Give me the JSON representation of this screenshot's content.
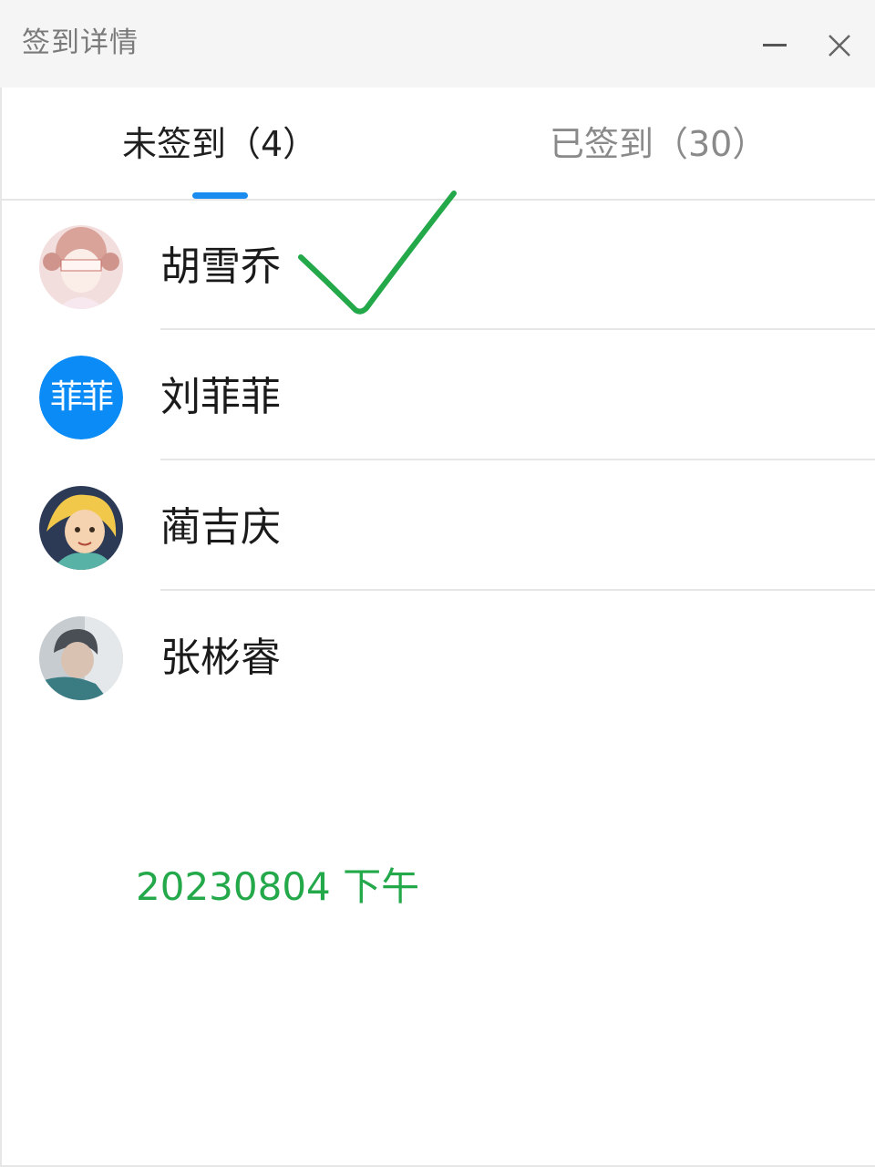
{
  "window": {
    "title": "签到详情",
    "minimize_icon": "minimize-icon",
    "close_icon": "close-icon"
  },
  "tabs": [
    {
      "label": "未签到（4）",
      "active": true
    },
    {
      "label": "已签到（30）",
      "active": false
    }
  ],
  "colors": {
    "accent": "#1a8cf0",
    "annotation_green": "#23a84a",
    "avatar_blue": "#0b8bf5"
  },
  "members": [
    {
      "name": "胡雪乔",
      "avatar": "cartoon-girl-avatar"
    },
    {
      "name": "刘菲菲",
      "avatar": "text-avatar",
      "avatar_text": "菲菲"
    },
    {
      "name": "蔺吉庆",
      "avatar": "cartoon-princess-avatar"
    },
    {
      "name": "张彬睿",
      "avatar": "photo-avatar"
    }
  ],
  "annotation": {
    "checkmark": "handwritten-checkmark-icon",
    "note": "20230804 下午"
  }
}
